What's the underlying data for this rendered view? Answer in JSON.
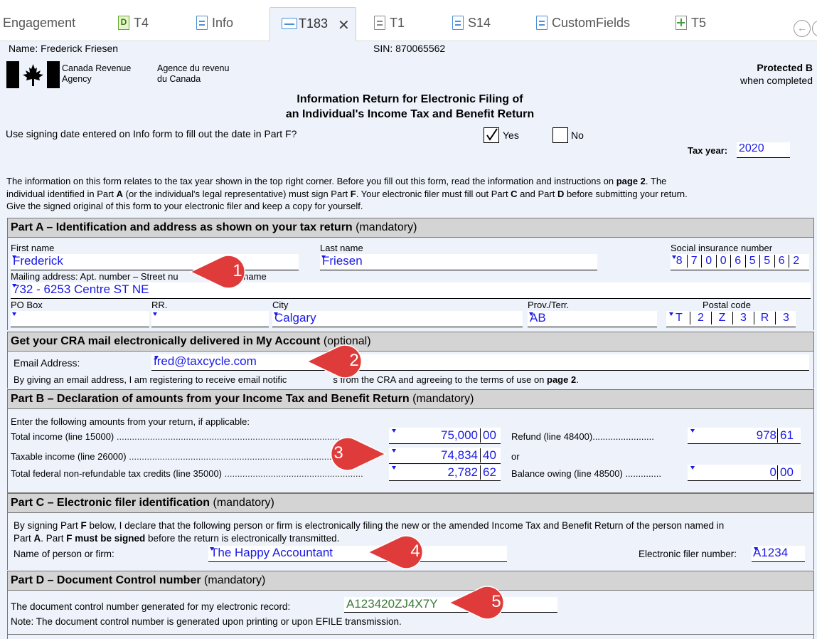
{
  "tabs": [
    {
      "label": "Engagement",
      "icon": "none"
    },
    {
      "label": "T4",
      "icon": "d-icon"
    },
    {
      "label": "Info",
      "icon": "doc-icon"
    },
    {
      "label": "T183",
      "icon": "t183-icon"
    },
    {
      "label": "T1",
      "icon": "doc-icon"
    },
    {
      "label": "S14",
      "icon": "doc-icon"
    },
    {
      "label": "CustomFields",
      "icon": "doc-icon"
    },
    {
      "label": "T5",
      "icon": "plus-icon"
    }
  ],
  "nav_back": "←",
  "tab_close": "✕",
  "header": {
    "name_label": "Name:",
    "name_value": "Frederick Friesen",
    "sin_label": "SIN:",
    "sin_value": "870065562",
    "agency_en_1": "Canada Revenue",
    "agency_en_2": "Agency",
    "agency_fr_1": "Agence du revenu",
    "agency_fr_2": "du Canada",
    "protected": "Protected B",
    "when_completed": "when completed",
    "title_1": "Information Return for Electronic Filing of",
    "title_2": "an Individual's Income Tax and Benefit Return",
    "signing_question": "Use signing date entered on Info form to fill out the date in Part F?",
    "yes_label": "Yes",
    "no_label": "No",
    "yes_checked": true,
    "tax_year_label": "Tax year:",
    "tax_year": "2020"
  },
  "intro": {
    "line1_a": "The information on this form relates to the tax year shown in the top right corner. Before you fill out this form, read the information and instructions on ",
    "line1_b": "page 2",
    "line1_c": ". The",
    "line2_a": "individual identified in Part ",
    "line2_b": "A",
    "line2_c": " (or the individual's legal representative) must sign Part ",
    "line2_d": "F",
    "line2_e": ". Your electronic filer must fill out Part ",
    "line2_f": "C",
    "line2_g": " and Part ",
    "line2_h": "D",
    "line2_i": " before submitting your return.",
    "line3": "Give the signed original of this form to your electronic filer and keep a copy for yourself."
  },
  "part_a": {
    "title": "Part A – Identification and address as shown on your tax return",
    "suffix": "(mandatory)",
    "first_name_label": "First name",
    "first_name": "Frederick",
    "last_name_label": "Last name",
    "last_name": "Friesen",
    "sin_label": "Social insurance number",
    "sin_digits": [
      "8",
      "7",
      "0",
      "0",
      "6",
      "5",
      "5",
      "6",
      "2"
    ],
    "mailing_label_a": "Mailing address: Apt. number – Street nu",
    "mailing_label_b": "treet name",
    "mailing_value": "732 - 6253 Centre ST NE",
    "po_box_label": "PO Box",
    "rr_label": "RR.",
    "city_label": "City",
    "city": "Calgary",
    "prov_label": "Prov./Terr.",
    "prov": "AB",
    "postal_label": "Postal code",
    "postal_chars": [
      "T",
      "2",
      "Z",
      "3",
      "R",
      "3"
    ]
  },
  "cra_mail": {
    "title": "Get your CRA mail electronically delivered in My Account",
    "suffix": "(optional)",
    "email_label": "Email Address:",
    "email": "fred@taxcycle.com",
    "consent_a": "By giving an email address, I am registering to receive email notific",
    "consent_b": "s from the CRA and agreeing to the terms of use on ",
    "consent_c": "page 2",
    "consent_d": "."
  },
  "part_b": {
    "title": "Part B – Declaration of amounts from your Income Tax and Benefit Return",
    "suffix": "(mandatory)",
    "intro": "Enter the following amounts from your return, if applicable:",
    "rows": [
      {
        "label": "Total income (line 15000)",
        "dollars": "75,000",
        "cents": "00"
      },
      {
        "label": "Taxable income (line 26000)",
        "dollars": "74,834",
        "cents": "40"
      },
      {
        "label": "Total federal non-refundable tax credits (line 35000)",
        "dollars": "2,782",
        "cents": "62"
      }
    ],
    "refund_label": "Refund (line 48400)",
    "refund_dollars": "978",
    "refund_cents": "61",
    "or_label": "or",
    "balance_label": "Balance owing (line 48500)",
    "balance_dollars": "0",
    "balance_cents": "00"
  },
  "part_c": {
    "title": "Part C – Electronic filer identification",
    "suffix": "(mandatory)",
    "text1_a": "By signing Part ",
    "text1_b": "F",
    "text1_c": " below, I declare that the following person or firm is electronically filing the new or the amended Income Tax and Benefit Return of the person named in",
    "text2_a": "Part ",
    "text2_b": "A",
    "text2_c": ". Part ",
    "text2_d": "F must be signed",
    "text2_e": " before the return is electronically transmitted.",
    "name_label": "Name of person or firm:",
    "name_value": "The Happy Accountant",
    "filer_label": "Electronic filer number:",
    "filer_value": "A1234"
  },
  "part_d": {
    "title": "Part D – Document Control number",
    "suffix": "(mandatory)",
    "dcn_label": "The document control number generated for my electronic record:",
    "dcn_value": "A123420ZJ4X7Y",
    "note": "Note: The document control number is generated upon printing or upon EFILE transmission."
  },
  "callouts": [
    "1",
    "2",
    "3",
    "4",
    "5"
  ],
  "colors": {
    "field_text": "#1a1ae6",
    "callout_red": "#e03b3b",
    "section_header": "#d4d4d4",
    "dcn_text": "#3a7a3a"
  }
}
